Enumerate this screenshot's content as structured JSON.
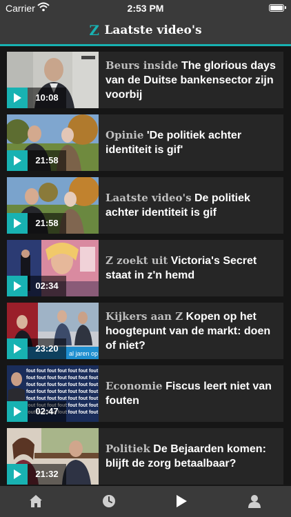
{
  "status_bar": {
    "carrier": "Carrier",
    "time": "2:53 PM"
  },
  "header": {
    "logo": "Z",
    "title": "Laatste video's"
  },
  "accent_color": "#18b2b2",
  "videos": [
    {
      "category": "Beurs inside",
      "title": "The glorious days van de Duitse bankensector zijn voorbij",
      "duration": "10:08"
    },
    {
      "category": "Opinie",
      "title": "'De politiek achter identiteit is gif'",
      "duration": "21:58"
    },
    {
      "category": "Laatste video's",
      "title": "De politiek achter identiteit is gif",
      "duration": "21:58"
    },
    {
      "category": "Z zoekt uit",
      "title": "Victoria's Secret staat in z'n hemd",
      "duration": "02:34"
    },
    {
      "category": "Kijkers aan Z",
      "title": "Kopen op het hoogtepunt van de markt: doen of niet?",
      "duration": "23:20"
    },
    {
      "category": "Economie",
      "title": "Fiscus leert niet van fouten",
      "duration": "02:47"
    },
    {
      "category": "Politiek",
      "title": "De Bejaarden komen: blijft de zorg betaalbaar?",
      "duration": "21:32"
    }
  ],
  "tab_bar": {
    "icons": [
      "home-icon",
      "clock-icon",
      "play-icon",
      "profile-icon"
    ]
  }
}
